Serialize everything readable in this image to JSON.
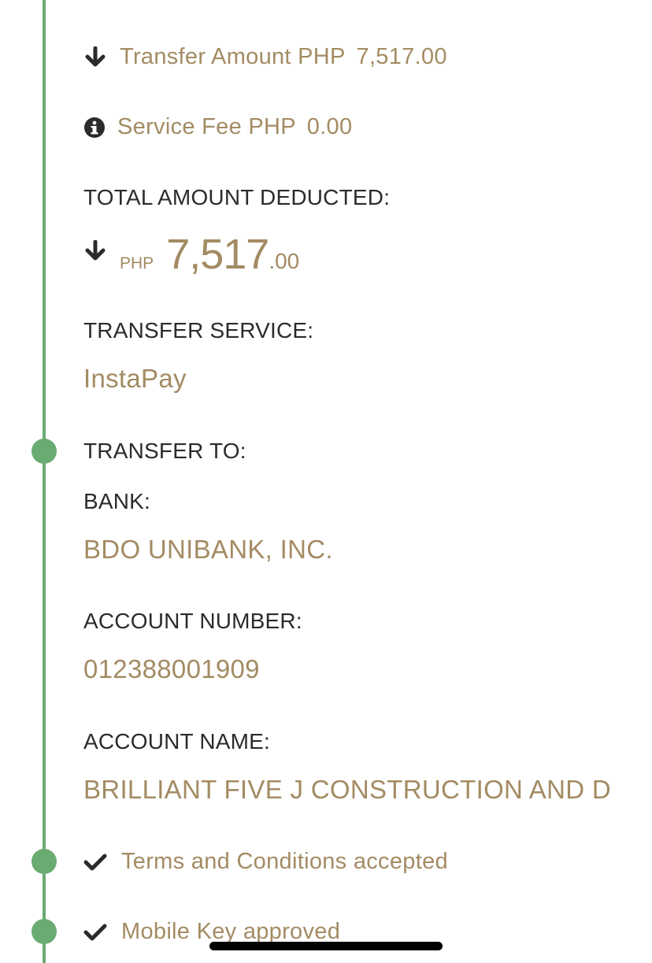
{
  "summary": {
    "transfer_amount_label": "Transfer Amount PHP",
    "transfer_amount_value": "7,517.00",
    "service_fee_label": "Service Fee PHP",
    "service_fee_value": "0.00"
  },
  "total": {
    "label": "TOTAL AMOUNT DEDUCTED:",
    "currency": "PHP",
    "whole": "7,517",
    "cents": ".00"
  },
  "transfer_service": {
    "label": "TRANSFER SERVICE:",
    "value": "InstaPay"
  },
  "transfer_to": {
    "label": "TRANSFER TO:",
    "bank_label": "BANK:",
    "bank_value": "BDO UNIBANK, INC.",
    "account_number_label": "ACCOUNT NUMBER:",
    "account_number_value": "012388001909",
    "account_name_label": "ACCOUNT NAME:",
    "account_name_value": "BRILLIANT FIVE J CONSTRUCTION AND D"
  },
  "steps": {
    "terms": "Terms and Conditions accepted",
    "mobile_key": "Mobile Key approved"
  },
  "colors": {
    "timeline": "#6aab71",
    "accent_text": "#a38b63",
    "label_text": "#2b2b2b"
  },
  "icons": {
    "transfer_amount": "arrow-down-icon",
    "service_fee": "info-circle-icon",
    "total": "arrow-down-icon",
    "terms": "checkmark-icon",
    "mobile_key": "checkmark-icon"
  }
}
